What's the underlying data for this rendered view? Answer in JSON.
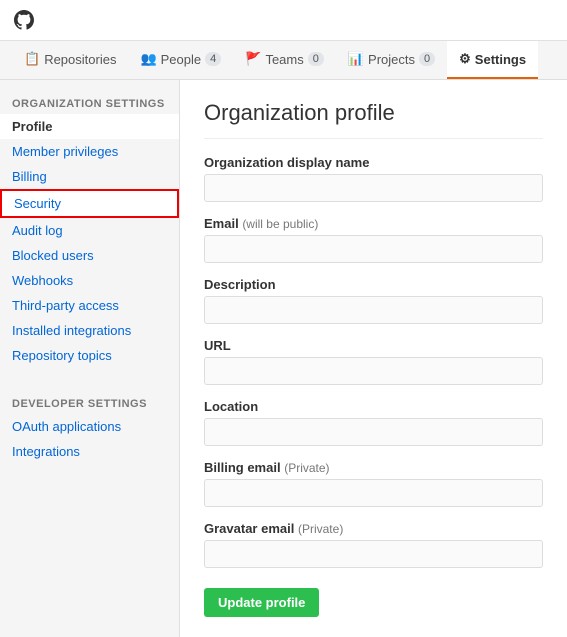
{
  "header": {
    "logo_alt": "GitHub"
  },
  "nav": {
    "tabs": [
      {
        "id": "repositories",
        "label": "Repositories",
        "icon": "📋",
        "badge": null,
        "active": false
      },
      {
        "id": "people",
        "label": "People",
        "icon": "👥",
        "badge": "4",
        "active": false
      },
      {
        "id": "teams",
        "label": "Teams",
        "icon": "🚩",
        "badge": "0",
        "active": false
      },
      {
        "id": "projects",
        "label": "Projects",
        "icon": "📊",
        "badge": "0",
        "active": false
      },
      {
        "id": "settings",
        "label": "Settings",
        "icon": "⚙",
        "badge": null,
        "active": true
      }
    ]
  },
  "sidebar": {
    "org_section_label": "Organization settings",
    "org_items": [
      {
        "id": "profile",
        "label": "Profile",
        "active": true,
        "highlighted": false
      },
      {
        "id": "member-privileges",
        "label": "Member privileges",
        "active": false,
        "highlighted": false
      },
      {
        "id": "billing",
        "label": "Billing",
        "active": false,
        "highlighted": false
      },
      {
        "id": "security",
        "label": "Security",
        "active": false,
        "highlighted": true
      },
      {
        "id": "audit-log",
        "label": "Audit log",
        "active": false,
        "highlighted": false
      },
      {
        "id": "blocked-users",
        "label": "Blocked users",
        "active": false,
        "highlighted": false
      },
      {
        "id": "webhooks",
        "label": "Webhooks",
        "active": false,
        "highlighted": false
      },
      {
        "id": "third-party-access",
        "label": "Third-party access",
        "active": false,
        "highlighted": false
      },
      {
        "id": "installed-integrations",
        "label": "Installed integrations",
        "active": false,
        "highlighted": false
      },
      {
        "id": "repository-topics",
        "label": "Repository topics",
        "active": false,
        "highlighted": false
      }
    ],
    "dev_section_label": "Developer settings",
    "dev_items": [
      {
        "id": "oauth-applications",
        "label": "OAuth applications",
        "active": false
      },
      {
        "id": "integrations",
        "label": "Integrations",
        "active": false
      }
    ]
  },
  "form": {
    "title": "Organization profile",
    "fields": [
      {
        "id": "display-name",
        "label": "Organization display name",
        "label_note": null,
        "placeholder": "",
        "value": ""
      },
      {
        "id": "email",
        "label": "Email",
        "label_note": "(will be public)",
        "placeholder": "",
        "value": ""
      },
      {
        "id": "description",
        "label": "Description",
        "label_note": null,
        "placeholder": "",
        "value": ""
      },
      {
        "id": "url",
        "label": "URL",
        "label_note": null,
        "placeholder": "",
        "value": ""
      },
      {
        "id": "location",
        "label": "Location",
        "label_note": null,
        "placeholder": "",
        "value": ""
      },
      {
        "id": "billing-email",
        "label": "Billing email",
        "label_note": "(Private)",
        "placeholder": "",
        "value": ""
      },
      {
        "id": "gravatar-email",
        "label": "Gravatar email",
        "label_note": "(Private)",
        "placeholder": "",
        "value": ""
      }
    ],
    "submit_label": "Update profile"
  }
}
